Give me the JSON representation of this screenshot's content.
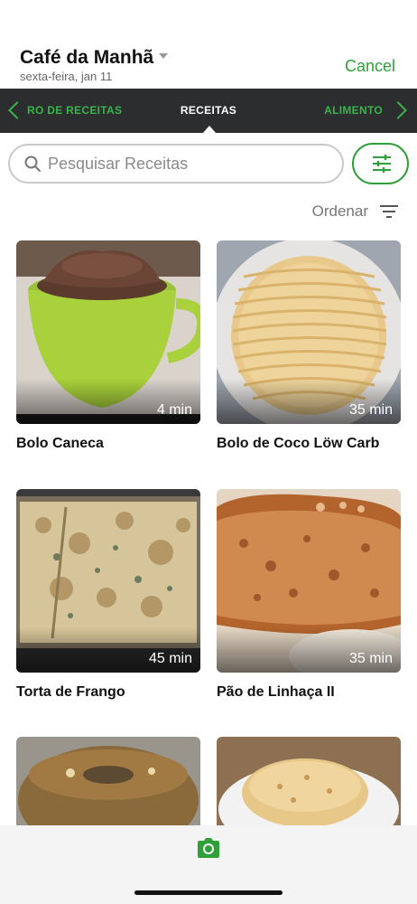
{
  "header": {
    "meal_title": "Café da Manhã",
    "meal_date": "sexta-feira, jan 11",
    "cancel_label": "Cancel"
  },
  "tabs": {
    "left_label": "RO DE RECEITAS",
    "center_label": "RECEITAS",
    "right_label": "ALIMENTO"
  },
  "search": {
    "placeholder": "Pesquisar Receitas"
  },
  "sort": {
    "label": "Ordenar"
  },
  "recipes": [
    {
      "title": "Bolo Caneca",
      "time": "4 min"
    },
    {
      "title": "Bolo de Coco Löw Carb",
      "time": "35 min"
    },
    {
      "title": "Torta de Frango",
      "time": "45 min"
    },
    {
      "title": "Pão de Linhaça II",
      "time": "35 min"
    },
    {
      "title": "",
      "time": ""
    },
    {
      "title": "",
      "time": ""
    }
  ],
  "colors": {
    "accent": "#2fa038",
    "tab_bar": "#2b2d2f"
  },
  "icons": {
    "search": "search-icon",
    "filter": "sliders-icon",
    "sort": "sort-icon",
    "camera": "camera-icon",
    "tab_prev": "chevron-left-icon",
    "tab_next": "chevron-right-icon"
  }
}
